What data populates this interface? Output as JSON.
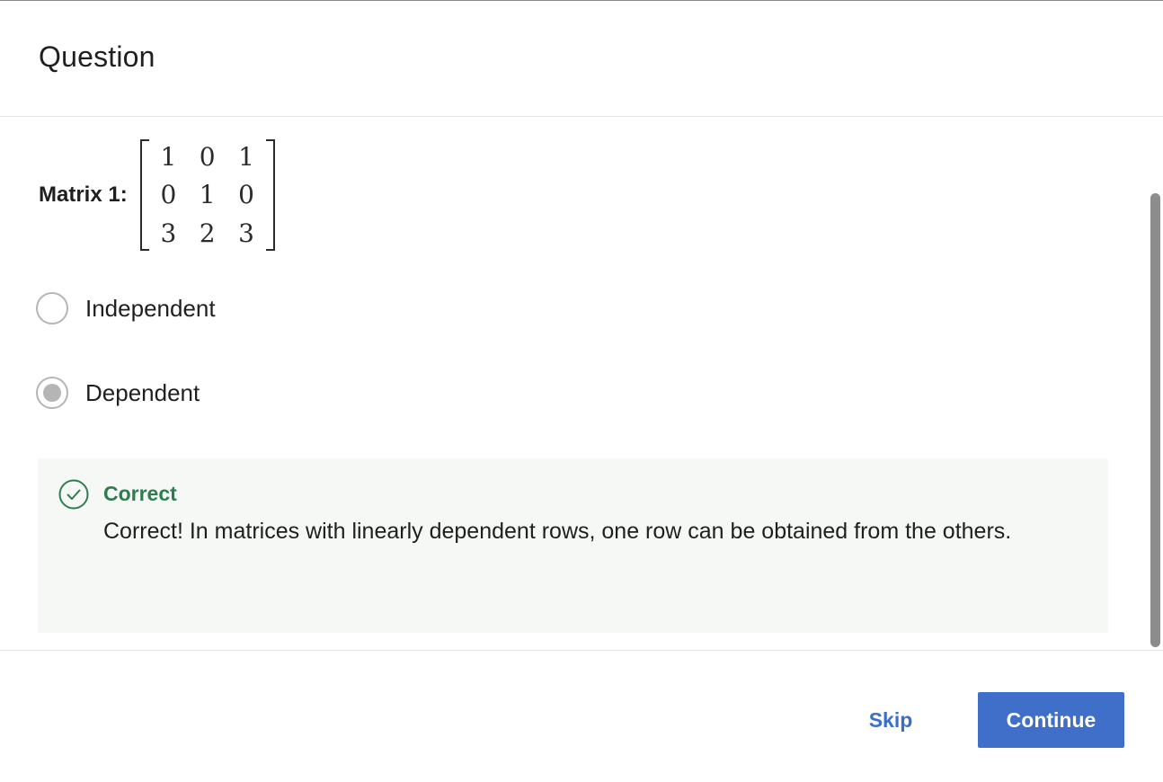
{
  "header": {
    "title": "Question"
  },
  "question": {
    "matrix_label": "Matrix 1:",
    "matrix": [
      [
        "1",
        "0",
        "1"
      ],
      [
        "0",
        "1",
        "0"
      ],
      [
        "3",
        "2",
        "3"
      ]
    ]
  },
  "options": [
    {
      "label": "Independent",
      "selected": false
    },
    {
      "label": "Dependent",
      "selected": true
    }
  ],
  "feedback": {
    "icon": "check-circle-icon",
    "status": "Correct",
    "message": "Correct! In matrices with linearly dependent rows, one row can be obtained from the others.",
    "status_color": "#2e7d4f"
  },
  "footer": {
    "skip_label": "Skip",
    "continue_label": "Continue",
    "accent_color": "#3f6fc9"
  }
}
